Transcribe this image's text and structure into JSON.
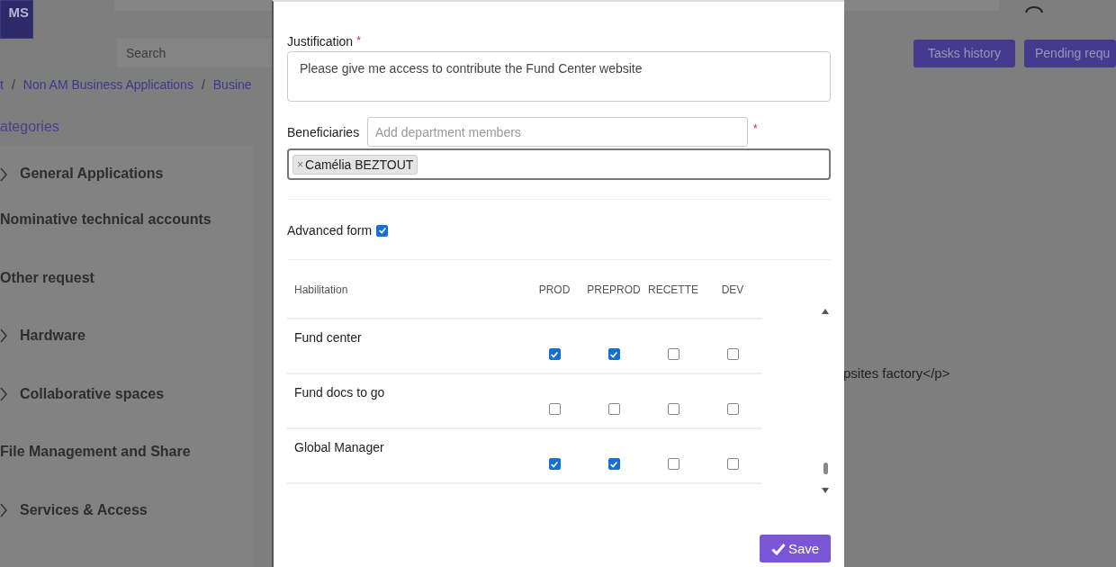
{
  "header": {
    "logo": "MS",
    "search": {
      "placeholder": "Search"
    },
    "buttons": [
      "Tasks history",
      "Pending requ"
    ]
  },
  "breadcrumb": {
    "separator": "/",
    "items": [
      "t",
      "Non AM Business Applications",
      "Busine"
    ]
  },
  "sidebar": {
    "title": "ategories",
    "items": [
      {
        "label": "General Applications",
        "kind": "group"
      },
      {
        "label": "Nominative technical accounts",
        "kind": "plain"
      },
      {
        "label": "Other request",
        "kind": "plain"
      },
      {
        "label": "Hardware",
        "kind": "group"
      },
      {
        "label": "Collaborative spaces",
        "kind": "group"
      },
      {
        "label": "File Management and Share",
        "kind": "plain"
      },
      {
        "label": "Services & Access",
        "kind": "group"
      }
    ]
  },
  "content": {
    "text": "psites factory</p>"
  },
  "modal": {
    "justification": {
      "label": "Justification",
      "required_mark": "*",
      "value": "Please give me access to contribute the Fund Center website"
    },
    "beneficiaries": {
      "label": "Beneficiaries",
      "placeholder": "Add department members",
      "required_mark": "*",
      "remove_mark": "×",
      "tags": [
        "Camélia BEZTOUT"
      ]
    },
    "advanced_form": {
      "label": "Advanced form",
      "checked": true
    },
    "table": {
      "columns": [
        "Habilitation",
        "PROD",
        "PREPROD",
        "RECETTE",
        "DEV"
      ],
      "rows": [
        {
          "name": "Fund center",
          "checks": [
            true,
            true,
            false,
            false
          ]
        },
        {
          "name": "Fund docs to go",
          "checks": [
            false,
            false,
            false,
            false
          ]
        },
        {
          "name": "Global Manager",
          "checks": [
            true,
            true,
            false,
            false
          ]
        }
      ]
    },
    "save": "Save"
  }
}
